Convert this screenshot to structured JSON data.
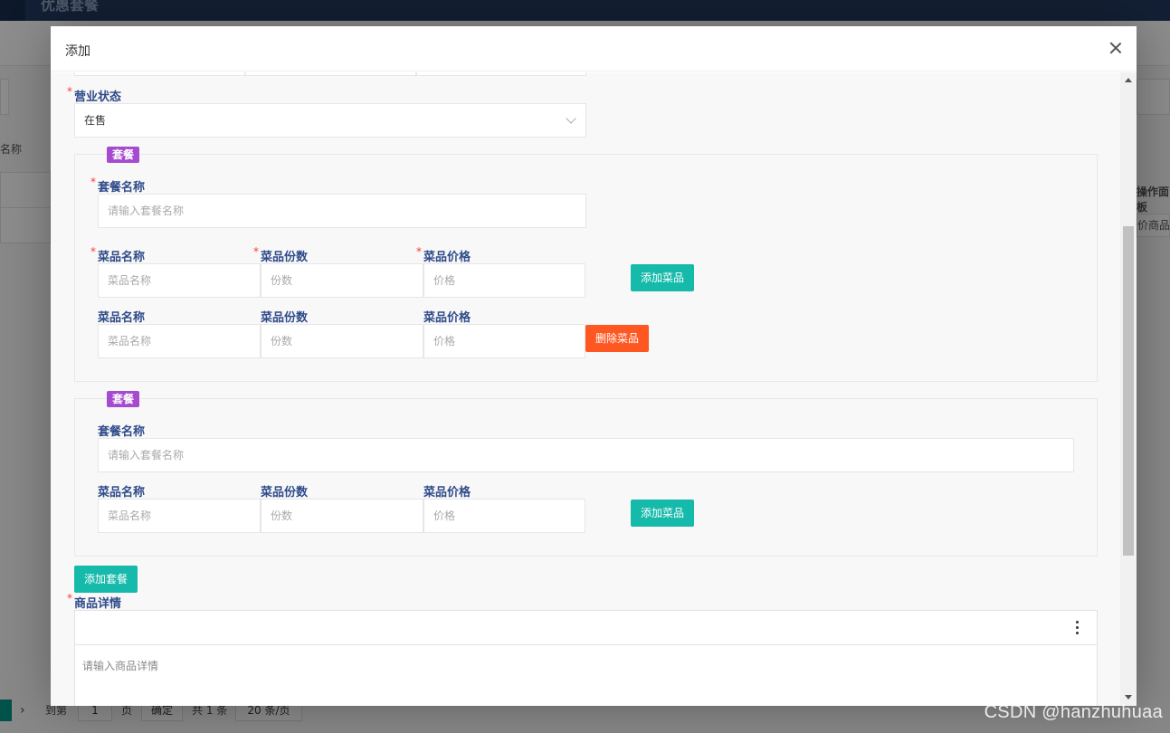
{
  "background": {
    "header_title": "优惠套餐",
    "left_fragment": "名称",
    "right_header": "操作面板",
    "right_cell": "价商品",
    "pager": {
      "goto_label": "到第",
      "page_value": "1",
      "page_unit": "页",
      "confirm": "确定",
      "total": "共 1 条",
      "page_size": "20 条/页"
    }
  },
  "modal": {
    "title": "添加",
    "business_status": {
      "label": "营业状态",
      "value": "在售"
    },
    "combos": [
      {
        "legend": "套餐",
        "name_label": "套餐名称",
        "name_placeholder": "请输入套餐名称",
        "dish_rows": [
          {
            "name_label": "菜品名称",
            "qty_label": "菜品份数",
            "price_label": "菜品价格",
            "name_placeholder": "菜品名称",
            "qty_placeholder": "份数",
            "price_placeholder": "价格",
            "action": "添加菜品"
          },
          {
            "name_label": "菜品名称",
            "qty_label": "菜品份数",
            "price_label": "菜品价格",
            "name_placeholder": "菜品名称",
            "qty_placeholder": "份数",
            "price_placeholder": "价格",
            "action": "删除菜品"
          }
        ]
      },
      {
        "legend": "套餐",
        "name_label": "套餐名称",
        "name_placeholder": "请输入套餐名称",
        "dish_rows": [
          {
            "name_label": "菜品名称",
            "qty_label": "菜品份数",
            "price_label": "菜品价格",
            "name_placeholder": "菜品名称",
            "qty_placeholder": "份数",
            "price_placeholder": "价格",
            "action": "添加菜品"
          }
        ]
      }
    ],
    "add_combo_button": "添加套餐",
    "detail": {
      "label": "商品详情",
      "placeholder": "请输入商品详情"
    },
    "icons": {
      "close": "close-icon",
      "more": "more-vertical-icon",
      "select": "chevron-down-icon"
    },
    "colors": {
      "accent": "#16baaa",
      "danger": "#ff5722",
      "legend": "#a64bd0",
      "label": "#2f4b8a",
      "required": "#ff3b30"
    }
  },
  "watermark": "CSDN @hanzhuhuaa"
}
